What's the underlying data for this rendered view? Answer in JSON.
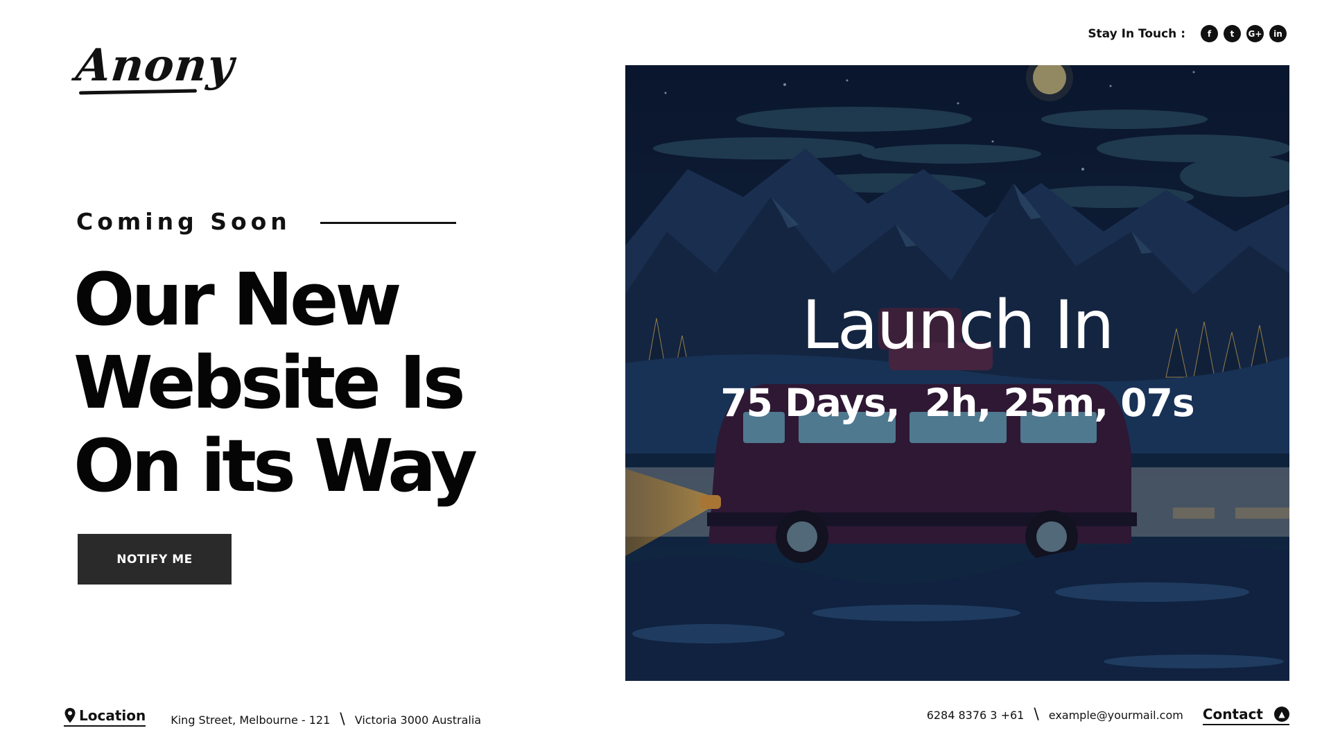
{
  "brand": {
    "logo_text": "Anony"
  },
  "social": {
    "label": "Stay In Touch :",
    "icons": [
      {
        "name": "facebook-icon",
        "glyph": "f"
      },
      {
        "name": "twitter-icon",
        "glyph": "t"
      },
      {
        "name": "google-plus-icon",
        "glyph": "G+"
      },
      {
        "name": "linkedin-icon",
        "glyph": "in"
      }
    ]
  },
  "hero": {
    "eyebrow": "Coming Soon",
    "headline_lines": [
      "Our New",
      "Website Is",
      "On its Way"
    ],
    "cta_label": "NOTIFY ME"
  },
  "countdown": {
    "title": "Launch In",
    "value": "75 Days,  2h, 25m, 07s"
  },
  "footer": {
    "location_label": "Location",
    "address_line1": "King Street, Melbourne - 121",
    "address_line2": "Victoria 3000 Australia",
    "separator": "\\",
    "phone": "6284 8376 3 +61",
    "email": "example@yourmail.com",
    "contact_label": "Contact"
  },
  "colors": {
    "button_bg": "#2a2a2a",
    "text": "#0a0a0a",
    "sky": "#0c1a33"
  }
}
